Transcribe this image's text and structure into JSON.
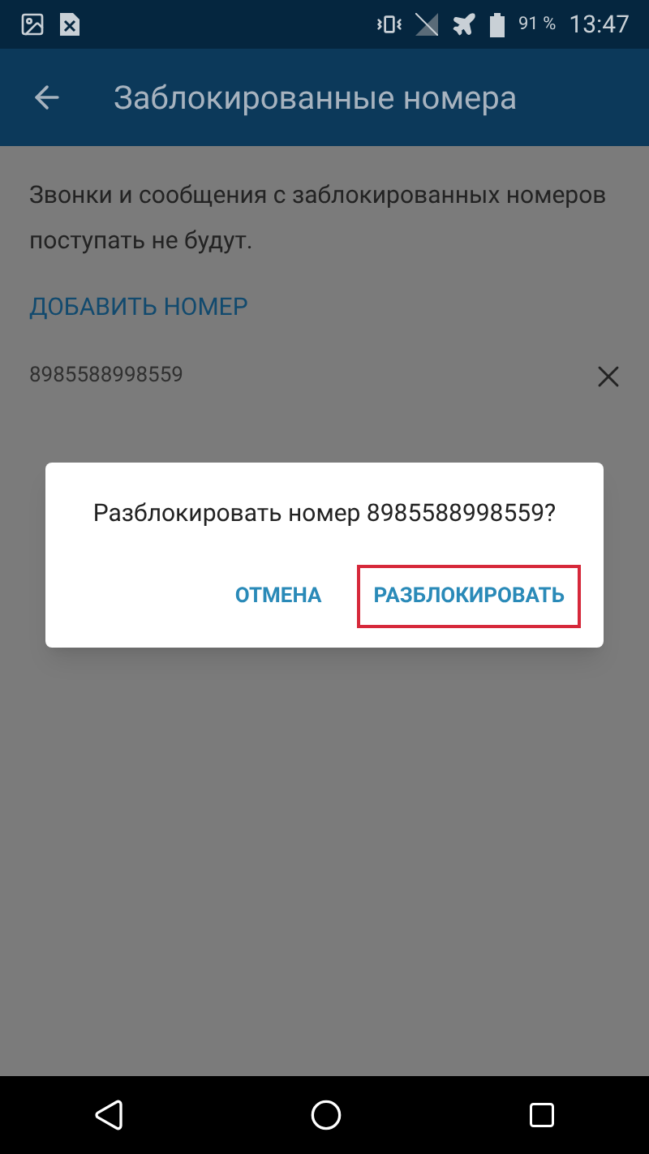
{
  "status_bar": {
    "battery": "91 %",
    "time": "13:47"
  },
  "app_bar": {
    "title": "Заблокированные номера"
  },
  "description": "Звонки и сообщения с заблокированных номеров поступать не будут.",
  "add_button": "ДОБАВИТЬ НОМЕР",
  "blocked_numbers": [
    {
      "number": "8985588998559"
    }
  ],
  "dialog": {
    "message": "Разблокировать номер 8985588998559?",
    "buttons": [
      {
        "label": "ОТМЕНА",
        "highlighted": false
      },
      {
        "label": "РАЗБЛОКИРОВАТЬ",
        "highlighted": true
      }
    ]
  }
}
